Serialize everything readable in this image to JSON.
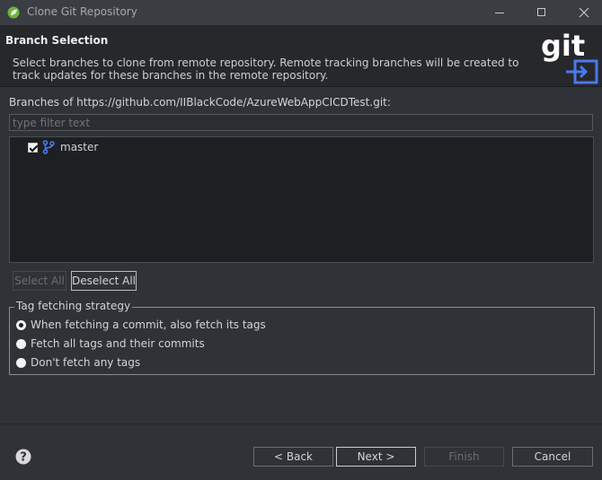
{
  "window": {
    "title": "Clone Git Repository",
    "icon": "spring-leaf-icon"
  },
  "header": {
    "title": "Branch Selection",
    "description": "Select branches to clone from remote repository. Remote tracking branches will be created to track updates for these branches in the remote repository.",
    "logo": "git"
  },
  "branches": {
    "label": "Branches of https://github.com/IIBlackCode/AzureWebAppCICDTest.git:",
    "filter_placeholder": "type filter text",
    "items": [
      {
        "name": "master",
        "checked": true,
        "icon": "branch-icon"
      }
    ],
    "select_all": "Select All",
    "deselect_all": "Deselect All"
  },
  "tag_strategy": {
    "legend": "Tag fetching strategy",
    "options": [
      {
        "label": "When fetching a commit, also fetch its tags",
        "selected": true
      },
      {
        "label": "Fetch all tags and their commits",
        "selected": false
      },
      {
        "label": "Don't fetch any tags",
        "selected": false
      }
    ]
  },
  "footer": {
    "back": "< Back",
    "next": "Next >",
    "finish": "Finish",
    "cancel": "Cancel"
  },
  "colors": {
    "background": "#2f3236",
    "header_bg": "#26282b",
    "accent_blue": "#4a78f0"
  }
}
